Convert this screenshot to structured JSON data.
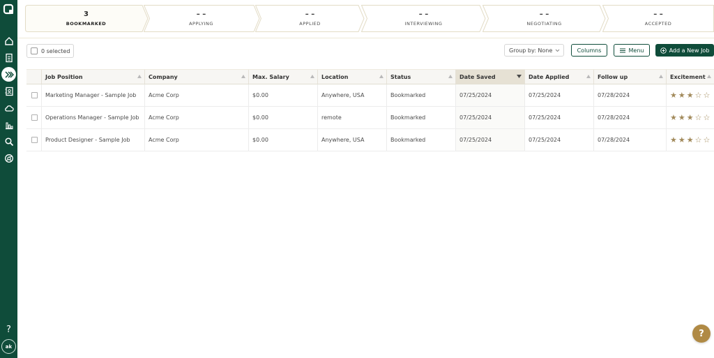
{
  "sidebar": {
    "items": [
      {
        "name": "home-icon"
      },
      {
        "name": "document-icon"
      },
      {
        "name": "pipeline-icon"
      },
      {
        "name": "contacts-icon"
      },
      {
        "name": "cloud-icon"
      },
      {
        "name": "chart-icon"
      },
      {
        "name": "search-icon"
      },
      {
        "name": "chrome-icon"
      }
    ],
    "help_label": "?",
    "avatar_initials": "ak"
  },
  "pipeline": {
    "stages": [
      {
        "count": "3",
        "label": "BOOKMARKED"
      },
      {
        "count": "– –",
        "label": "APPLYING"
      },
      {
        "count": "– –",
        "label": "APPLIED"
      },
      {
        "count": "– –",
        "label": "INTERVIEWING"
      },
      {
        "count": "– –",
        "label": "NEGOTIATING"
      },
      {
        "count": "– –",
        "label": "ACCEPTED"
      }
    ]
  },
  "toolbar": {
    "selected_label": "0 selected",
    "group_by_label": "Group by: None",
    "columns_label": "Columns",
    "menu_label": "Menu",
    "add_job_label": "Add a New Job"
  },
  "table": {
    "columns": [
      "Job Position",
      "Company",
      "Max. Salary",
      "Location",
      "Status",
      "Date Saved",
      "Date Applied",
      "Follow up",
      "Excitement"
    ],
    "sorted_column": "Date Saved",
    "rows": [
      {
        "position": "Marketing Manager - Sample Job",
        "company": "Acme Corp",
        "salary": "$0.00",
        "location": "Anywhere, USA",
        "status": "Bookmarked",
        "date_saved": "07/25/2024",
        "date_applied": "07/25/2024",
        "follow_up": "07/28/2024",
        "excitement": 3
      },
      {
        "position": "Operations Manager - Sample Job",
        "company": "Acme Corp",
        "salary": "$0.00",
        "location": "remote",
        "status": "Bookmarked",
        "date_saved": "07/25/2024",
        "date_applied": "07/25/2024",
        "follow_up": "07/28/2024",
        "excitement": 3
      },
      {
        "position": "Product Designer - Sample Job",
        "company": "Acme Corp",
        "salary": "$0.00",
        "location": "Anywhere, USA",
        "status": "Bookmarked",
        "date_saved": "07/25/2024",
        "date_applied": "07/25/2024",
        "follow_up": "07/28/2024",
        "excitement": 3
      }
    ]
  },
  "help_fab_label": "?",
  "colors": {
    "brand": "#0f4c3a",
    "accent": "#b08a45",
    "star": "#a28a5b"
  }
}
